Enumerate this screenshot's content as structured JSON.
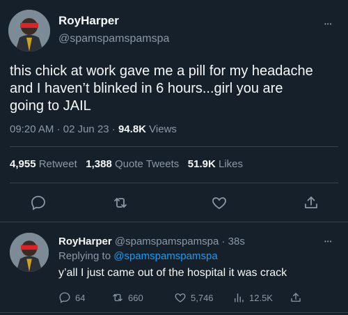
{
  "main_tweet": {
    "display_name": "RoyHarper",
    "handle": "@spamspamspamspa",
    "text": "this chick at work gave me a pill for my headache and I haven’t blinked in 6 hours...girl you are going to JAIL",
    "time": "09:20 AM",
    "date": "02 Jun 23",
    "separator": "·",
    "views_count": "94.8K",
    "views_label": "Views",
    "retweets_count": "4,955",
    "retweets_label": "Retweet",
    "quotes_count": "1,388",
    "quotes_label": "Quote Tweets",
    "likes_count": "51.9K",
    "likes_label": "Likes",
    "more_glyph": "•••"
  },
  "reply_tweet": {
    "display_name": "RoyHarper",
    "handle": "@spamspamspamspa",
    "separator": "·",
    "age": "38s",
    "replying_to_label": "Replying to",
    "replying_to_handle": "@spamspamspamspa",
    "text": "y’all I just came out of the hospital it was crack",
    "reply_count": "64",
    "retweet_count": "660",
    "like_count": "5,746",
    "views_count": "12.5K",
    "more_glyph": "•••"
  },
  "icons": [
    "reply-icon",
    "retweet-icon",
    "like-icon",
    "share-icon",
    "views-icon",
    "more-icon"
  ],
  "colors": {
    "background": "#15202b",
    "text": "#f7f9f9",
    "muted": "#8b98a5",
    "link": "#1d9bf0",
    "divider": "#38444d"
  }
}
